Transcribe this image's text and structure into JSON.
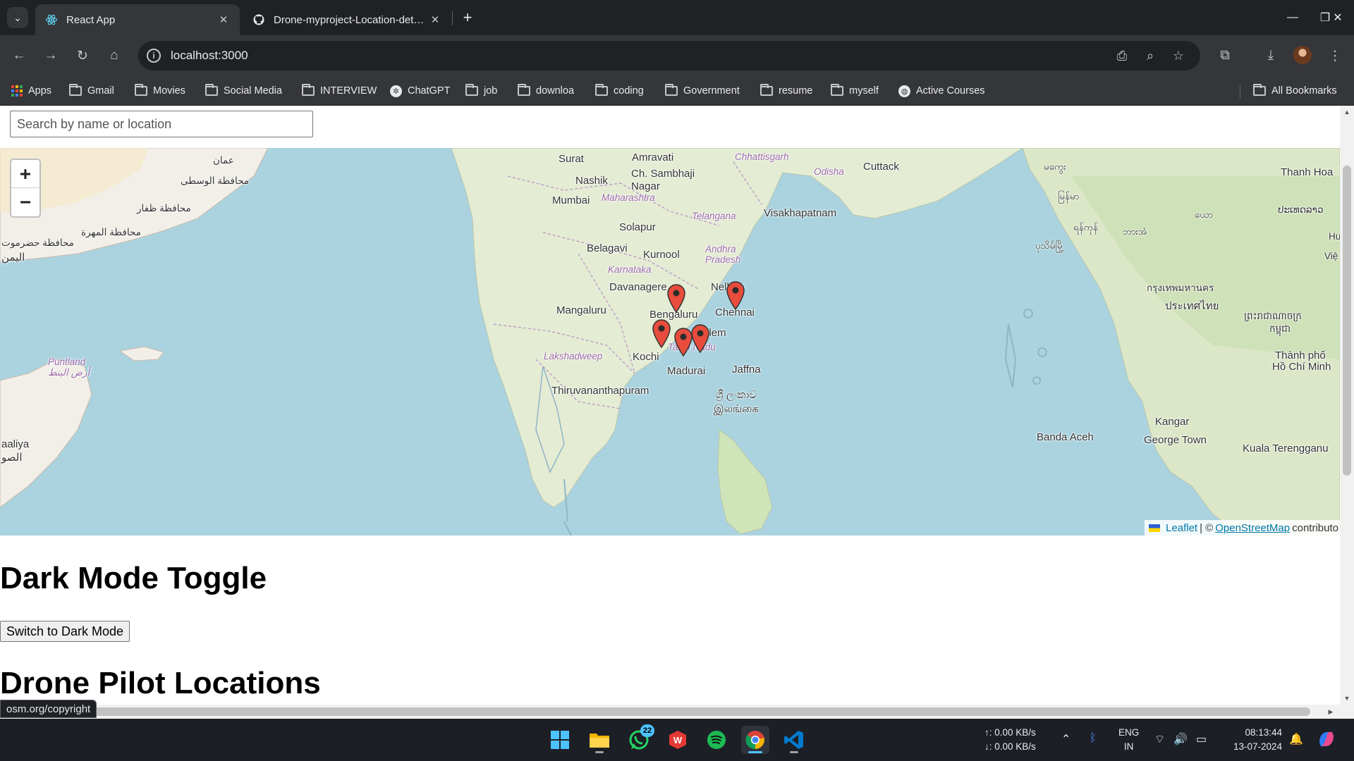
{
  "browser": {
    "tabs": [
      {
        "title": "React App",
        "active": true
      },
      {
        "title": "Drone-myproject-Location-detection",
        "active": false
      }
    ],
    "tab_close_glyph": "✕",
    "new_tab_glyph": "+",
    "url": "localhost:3000",
    "bookmarks": [
      {
        "label": "Apps",
        "icon": "apps-grid-icon"
      },
      {
        "label": "Gmail",
        "icon": "folder-icon"
      },
      {
        "label": "Movies",
        "icon": "folder-icon"
      },
      {
        "label": "Social Media",
        "icon": "folder-icon"
      },
      {
        "label": "INTERVIEW",
        "icon": "folder-icon"
      },
      {
        "label": "ChatGPT",
        "icon": "chatgpt-icon"
      },
      {
        "label": "job",
        "icon": "folder-icon"
      },
      {
        "label": "downloa",
        "icon": "folder-icon"
      },
      {
        "label": "coding",
        "icon": "folder-icon"
      },
      {
        "label": "Government",
        "icon": "folder-icon"
      },
      {
        "label": "resume",
        "icon": "folder-icon"
      },
      {
        "label": "myself",
        "icon": "folder-icon"
      },
      {
        "label": "Active Courses",
        "icon": "globe-icon"
      }
    ],
    "all_bookmarks": "All Bookmarks",
    "status_tip": "osm.org/copyright"
  },
  "page": {
    "search_placeholder": "Search by name or location",
    "map": {
      "zoom_in": "+",
      "zoom_out": "−",
      "attribution": {
        "leaflet": "Leaflet",
        "sep": "| ©",
        "osm": "OpenStreetMap",
        "contrib": "contributo"
      },
      "labels": {
        "surat": "Surat",
        "amravati": "Amravati",
        "chhattisgarh": "Chhattisgarh",
        "cuttack": "Cuttack",
        "nashik": "Nashik",
        "sambhaji": "Ch. Sambhaji Nagar",
        "mumbai": "Mumbai",
        "maharashtra": "Maharashtra",
        "odisha": "Odisha",
        "telangana": "Telangana",
        "visakhapatnam": "Visakhapatnam",
        "solapur": "Solapur",
        "belagavi": "Belagavi",
        "kurnool": "Kurnool",
        "andhra": "Andhra Pradesh",
        "karnataka": "Karnataka",
        "davanagere": "Davanagere",
        "nellore": "Nellore",
        "mangaluru": "Mangaluru",
        "bengaluru": "Bengaluru",
        "chennai": "Chennai",
        "salem": "Salem",
        "tamilnadu": "Tamil Nadu",
        "lakshadweep": "Lakshadweep",
        "kochi": "Kochi",
        "madurai": "Madurai",
        "jaffna": "Jaffna",
        "thiruvananthapuram": "Thiruvananthapuram",
        "srilanka1": "ශ්‍රී ලංකාව",
        "srilanka2": "இலங்கை",
        "oman": "عمان",
        "wusta": "محافظة الوسطى",
        "dhofar": "محافظة ظفار",
        "mahra": "محافظة المهرة",
        "hadramout": "محافظة حضرموت",
        "yemen": "اليمن",
        "puntland1": "Puntland",
        "puntland2": "أرض البنط",
        "somalia1": "aaliya",
        "somalia2": "الصو",
        "thanhhoa": "Thanh Hoa",
        "laos": "ປະເທດລາວ",
        "myanmar1": "မြန်မာ",
        "myanmar2": "မကွေး",
        "yangon": "ရန်ကုန်",
        "myeik": "ဘားအံ",
        "thailand1": "กรุงเทพมหานคร",
        "thailand2": "ประเทศไทย",
        "cambodia1": "ព្រះរាជាណាចក្រ",
        "cambodia2": "កម្ពុជា",
        "hcmc1": "Thành phố",
        "hcmc2": "Hồ Chí Minh",
        "kangar": "Kangar",
        "bandaaceh": "Banda Aceh",
        "georgetown": "George Town",
        "kuala": "Kuala Terengganu",
        "viet": "Việ",
        "hue": "Hu",
        "pathein": "ပုသိမ်မြို့",
        "mawlamyine": "ယော"
      },
      "marker_color": "#e74c3c"
    },
    "dark_mode_heading": "Dark Mode Toggle",
    "dark_mode_button": "Switch to Dark Mode",
    "pilots_heading": "Drone Pilot Locations"
  },
  "taskbar": {
    "whatsapp_badge": "22",
    "net_up": "↑: 0.00 KB/s",
    "net_down": "↓: 0.00 KB/s",
    "lang1": "ENG",
    "lang2": "IN",
    "time": "08:13:44",
    "date": "13-07-2024"
  }
}
